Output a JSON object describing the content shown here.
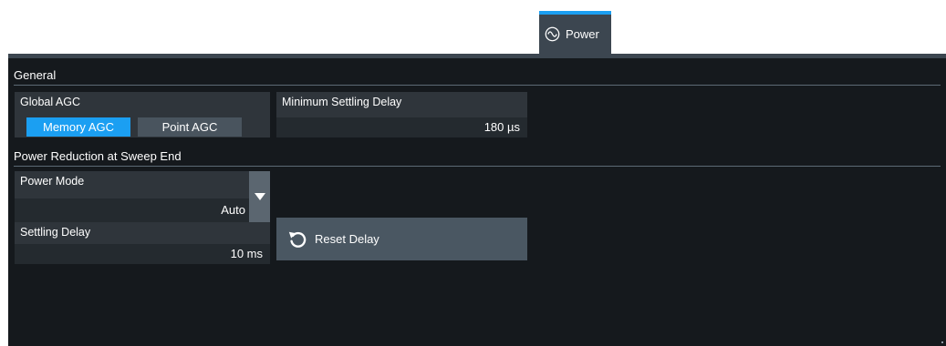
{
  "tab": {
    "label": "Power",
    "icon": "sine-wave-circle-icon"
  },
  "general": {
    "title": "General",
    "global_agc": {
      "label": "Global AGC",
      "options": [
        "Memory AGC",
        "Point AGC"
      ],
      "selected": "Memory AGC"
    },
    "min_settling_delay": {
      "label": "Minimum Settling Delay",
      "value": "180 µs"
    }
  },
  "power_reduction": {
    "title": "Power Reduction at Sweep End",
    "power_mode": {
      "label": "Power Mode",
      "value": "Auto"
    },
    "settling_delay": {
      "label": "Settling Delay",
      "value": "10 ms"
    },
    "reset_button": {
      "label": "Reset Delay",
      "icon": "reset-arrow-icon"
    }
  },
  "colors": {
    "accent": "#1b9ff2",
    "panel_bg": "#15191d",
    "box_bg": "#2f353b"
  }
}
